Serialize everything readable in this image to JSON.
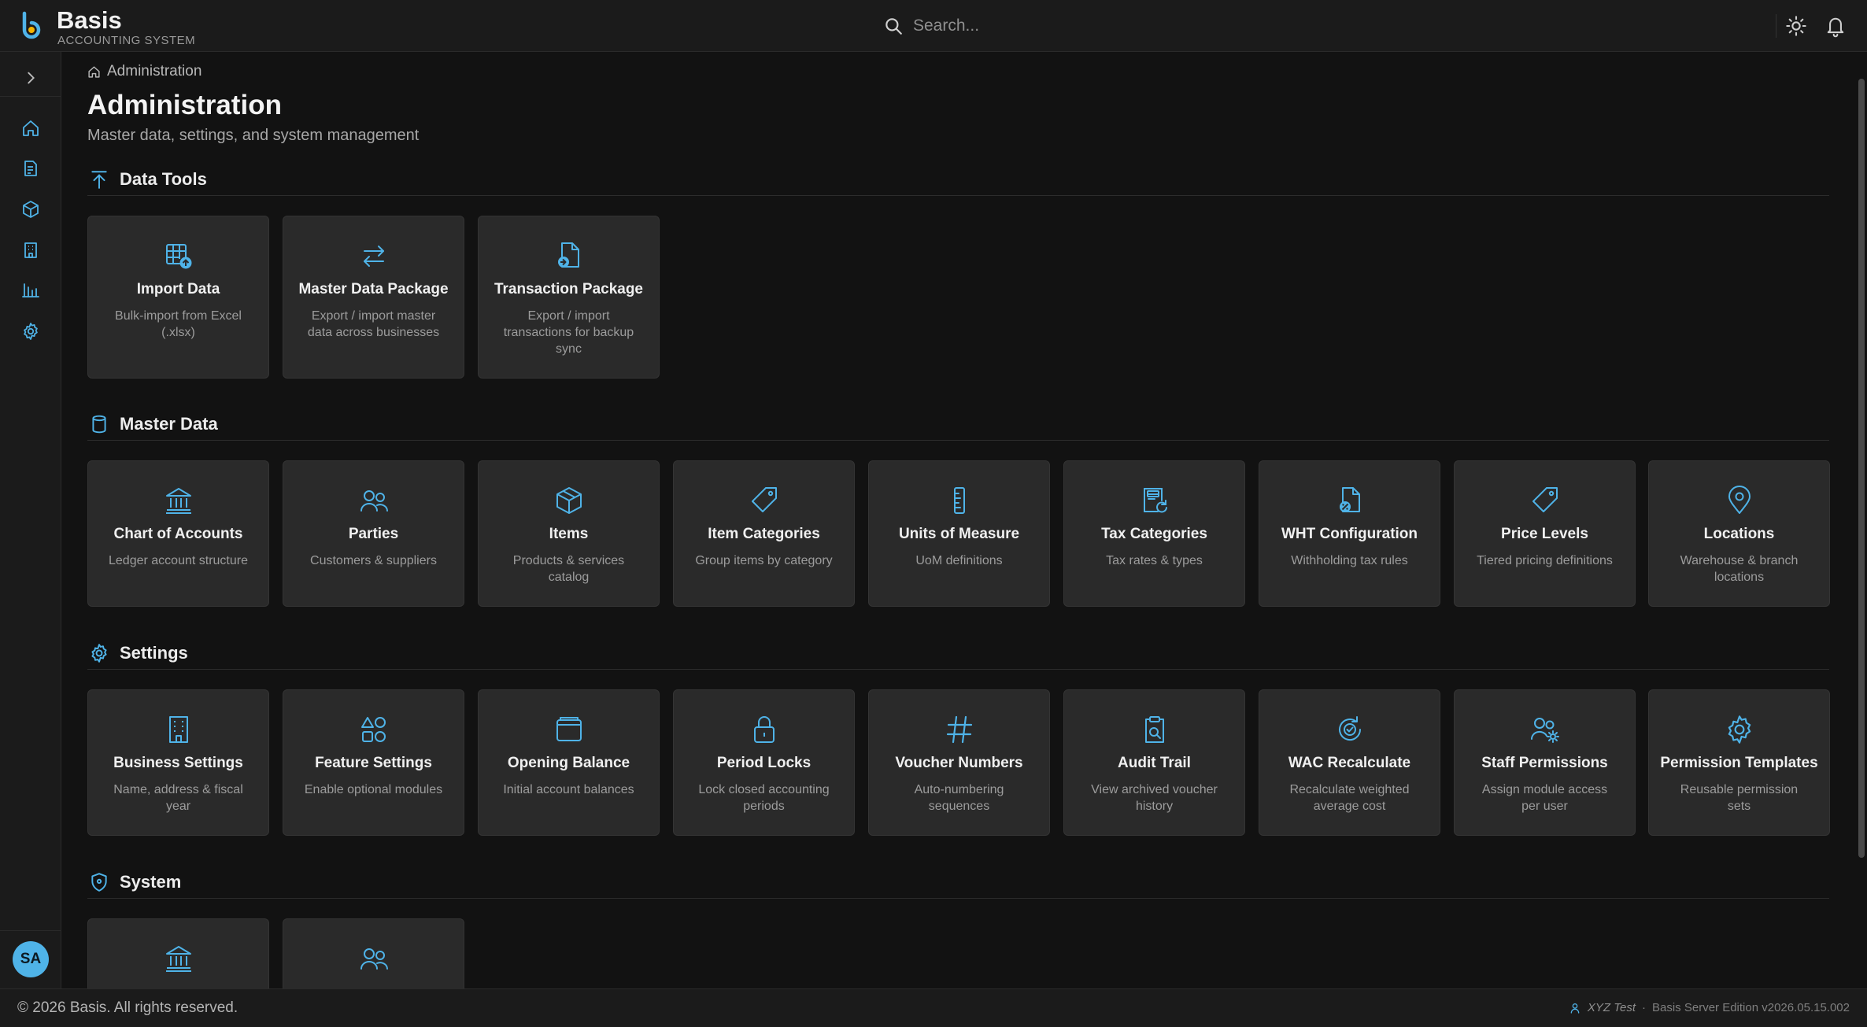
{
  "app": {
    "name": "Basis",
    "subtitle": "ACCOUNTING SYSTEM"
  },
  "search": {
    "placeholder": "Search..."
  },
  "avatar": {
    "initials": "SA"
  },
  "breadcrumb": {
    "current": "Administration"
  },
  "page": {
    "title": "Administration",
    "subtitle": "Master data, settings, and system management"
  },
  "sections": {
    "data_tools": {
      "title": "Data Tools",
      "cards": [
        {
          "title": "Import Data",
          "desc": "Bulk-import from Excel (.xlsx)"
        },
        {
          "title": "Master Data Package",
          "desc": "Export / import master data across businesses"
        },
        {
          "title": "Transaction Package",
          "desc": "Export / import transactions for backup sync"
        }
      ]
    },
    "master_data": {
      "title": "Master Data",
      "cards": [
        {
          "title": "Chart of Accounts",
          "desc": "Ledger account structure"
        },
        {
          "title": "Parties",
          "desc": "Customers & suppliers"
        },
        {
          "title": "Items",
          "desc": "Products & services catalog"
        },
        {
          "title": "Item Categories",
          "desc": "Group items by category"
        },
        {
          "title": "Units of Measure",
          "desc": "UoM definitions"
        },
        {
          "title": "Tax Categories",
          "desc": "Tax rates & types"
        },
        {
          "title": "WHT Configuration",
          "desc": "Withholding tax rules"
        },
        {
          "title": "Price Levels",
          "desc": "Tiered pricing definitions"
        },
        {
          "title": "Locations",
          "desc": "Warehouse & branch locations"
        }
      ]
    },
    "settings": {
      "title": "Settings",
      "cards": [
        {
          "title": "Business Settings",
          "desc": "Name, address & fiscal year"
        },
        {
          "title": "Feature Settings",
          "desc": "Enable optional modules"
        },
        {
          "title": "Opening Balance",
          "desc": "Initial account balances"
        },
        {
          "title": "Period Locks",
          "desc": "Lock closed accounting periods"
        },
        {
          "title": "Voucher Numbers",
          "desc": "Auto-numbering sequences"
        },
        {
          "title": "Audit Trail",
          "desc": "View archived voucher history"
        },
        {
          "title": "WAC Recalculate",
          "desc": "Recalculate weighted average cost"
        },
        {
          "title": "Staff Permissions",
          "desc": "Assign module access per user"
        },
        {
          "title": "Permission Templates",
          "desc": "Reusable permission sets"
        }
      ]
    },
    "system": {
      "title": "System"
    }
  },
  "footer": {
    "copyright": "© 2026 Basis. All rights reserved.",
    "user": "XYZ Test",
    "separator": "·",
    "edition": "Basis Server Edition v2026.05.15.002"
  },
  "colors": {
    "accent": "#4fb3e8",
    "card": "#2a2a2a",
    "background": "#121212"
  }
}
